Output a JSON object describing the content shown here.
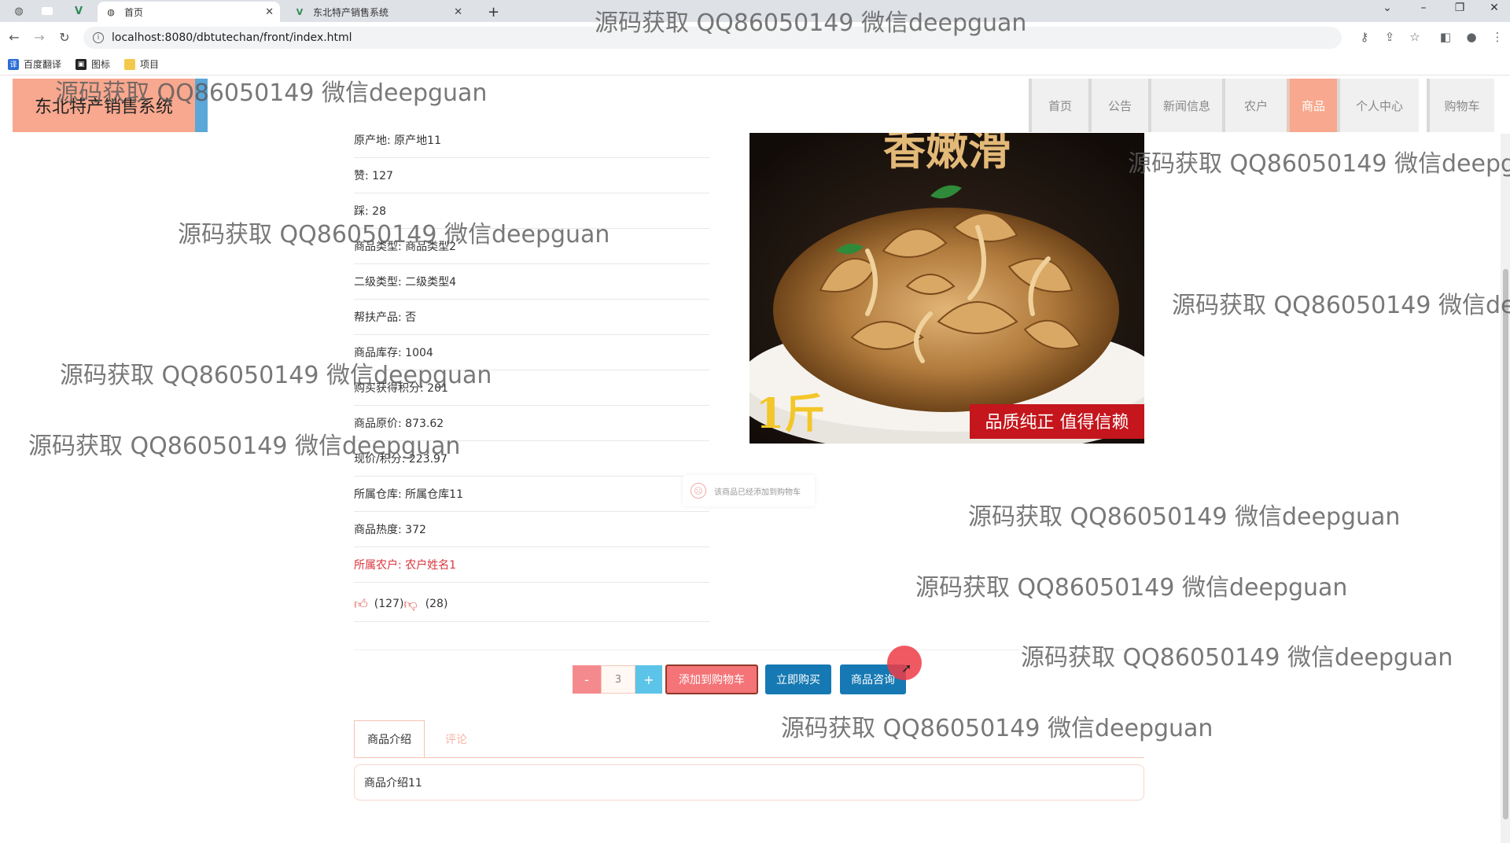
{
  "browser": {
    "tabs": [
      {
        "title": "首页",
        "active": true
      },
      {
        "title": "东北特产销售系统",
        "active": false
      }
    ],
    "new_tab_label": "+",
    "url": "localhost:8080/dbtutechan/front/index.html",
    "bookmarks": [
      "百度翻译",
      "图标",
      "项目"
    ]
  },
  "site": {
    "logo": "东北特产销售系统",
    "nav": [
      "首页",
      "公告",
      "新闻信息",
      "农户",
      "商品",
      "个人中心",
      "购物车"
    ],
    "active_nav": "商品"
  },
  "product": {
    "attributes": [
      "原产地: 原产地11",
      "赞: 127",
      "踩: 28",
      "商品类型: 商品类型2",
      "二级类型: 二级类型4",
      "帮扶产品: 否",
      "商品库存: 1004",
      "购买获得积分: 201",
      "商品原价: 873.62",
      "现价/积分: 223.97",
      "所属仓库: 所属仓库11",
      "商品热度: 372",
      "所属农户: 农户姓名1"
    ],
    "likes": "(127)",
    "dislikes": "(28)",
    "image": {
      "top_text": "香嫩滑",
      "weight_text": "1斤",
      "badge_text": "品质纯正 值得信赖"
    },
    "toast": "该商品已经添加到购物车",
    "quantity": "3",
    "minus_label": "-",
    "plus_label": "+",
    "buttons": {
      "add_cart": "添加到购物车",
      "buy_now": "立即购买",
      "consult": "商品咨询"
    },
    "detail_tabs": [
      "商品介绍",
      "评论"
    ],
    "description": "商品介绍11"
  },
  "watermark": "源码获取 QQ86050149 微信deepguan",
  "colors": {
    "primary_salmon": "#f8a88e",
    "accent_blue": "#1679b3",
    "minus_red": "#f48a8e",
    "plus_cyan": "#5bc4e8"
  }
}
